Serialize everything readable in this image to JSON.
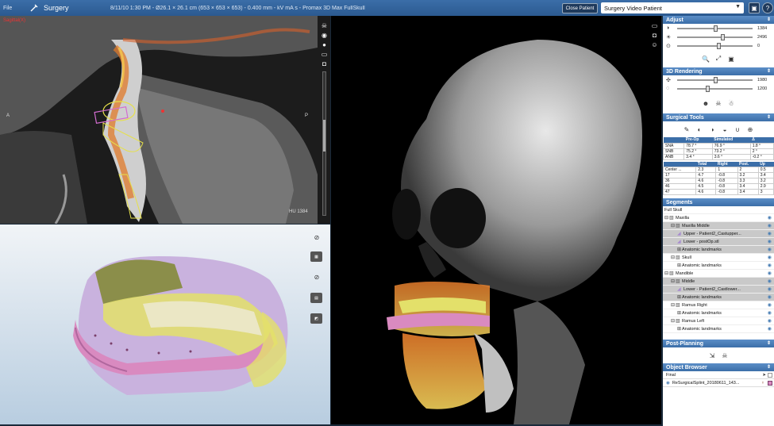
{
  "topbar": {
    "file_label": "File",
    "app_title": "Surgery",
    "scan_info": "8/11/10 1:30 PM - Ø26.1 × 26.1 cm (653 × 653 × 653) - 0.400 mm - kV mA s - Promax 3D Max FullSkull",
    "close_patient_label": "Close Patient",
    "patient_select_value": "Surgery Video Patient"
  },
  "sagittal_view": {
    "view_label": "Sagittal(X)",
    "orientation_left": "A",
    "orientation_right": "P",
    "hu_readout": "HU 1384"
  },
  "adjust": {
    "header": "Adjust",
    "sliders": [
      {
        "icon": "brightness-icon",
        "value": "1384",
        "fraction": 0.5
      },
      {
        "icon": "contrast-icon",
        "value": "2496",
        "fraction": 0.6
      },
      {
        "icon": "sharpness-icon",
        "value": "0",
        "fraction": 0.55
      }
    ]
  },
  "rendering": {
    "header": "3D Rendering",
    "sliders": [
      {
        "icon": "threshold-icon",
        "value": "1980",
        "fraction": 0.5
      },
      {
        "icon": "opacity-icon",
        "value": "1200",
        "fraction": 0.4
      }
    ]
  },
  "surgical_tools": {
    "header": "Surgical Tools",
    "ceph_headers": [
      "",
      "Pre-Op",
      "Simulated",
      "Δ"
    ],
    "ceph_rows": [
      [
        "SNA",
        "78.7 °",
        "76.9 °",
        "1.8 °"
      ],
      [
        "SNB",
        "75.2 °",
        "73.2 °",
        "2 °"
      ],
      [
        "ANB",
        "3.4 °",
        "3.6 °",
        "-0.2 °"
      ]
    ],
    "move_headers": [
      "",
      "Total",
      "Right",
      "Post.",
      "Up"
    ],
    "move_rows": [
      [
        "Center ...",
        "2.3",
        "1",
        "2",
        "0.5"
      ],
      [
        "17",
        "4.7",
        "-0.8",
        "3.2",
        "3.4"
      ],
      [
        "36",
        "4.6",
        "-0.8",
        "3.3",
        "3.2"
      ],
      [
        "46",
        "4.5",
        "-0.8",
        "3.4",
        "2.9"
      ],
      [
        "47",
        "4.6",
        "-0.8",
        "3.4",
        "3"
      ]
    ]
  },
  "segments": {
    "header": "Segments",
    "items": [
      {
        "label": "Full Skull",
        "level": 0,
        "selected": false,
        "tree": "",
        "icon": "",
        "eye": false
      },
      {
        "label": "Maxilla",
        "level": 0,
        "selected": false,
        "tree": "⊟",
        "icon": "bone-icon",
        "eye": true
      },
      {
        "label": "Maxilla Middle",
        "level": 1,
        "selected": true,
        "tree": "⊟",
        "icon": "bone-icon",
        "eye": true
      },
      {
        "label": "Upper - Patient2_Castupper...",
        "level": 2,
        "selected": true,
        "tree": "",
        "icon": "mesh-icon",
        "eye": true
      },
      {
        "label": "Lower - postOp.stl",
        "level": 2,
        "selected": true,
        "tree": "",
        "icon": "mesh-icon",
        "eye": true
      },
      {
        "label": "Anatomic landmarks",
        "level": 2,
        "selected": true,
        "tree": "⊞",
        "icon": "",
        "eye": true
      },
      {
        "label": "Skull",
        "level": 1,
        "selected": false,
        "tree": "⊟",
        "icon": "bone-icon",
        "eye": true
      },
      {
        "label": "Anatomic landmarks",
        "level": 2,
        "selected": false,
        "tree": "⊞",
        "icon": "",
        "eye": true
      },
      {
        "label": "Mandible",
        "level": 0,
        "selected": false,
        "tree": "⊟",
        "icon": "bone-icon",
        "eye": true
      },
      {
        "label": "Middle",
        "level": 1,
        "selected": true,
        "tree": "⊟",
        "icon": "bone-icon",
        "eye": true
      },
      {
        "label": "Lower - Patient2_Castlower...",
        "level": 2,
        "selected": true,
        "tree": "",
        "icon": "mesh-icon",
        "eye": true
      },
      {
        "label": "Anatomic landmarks",
        "level": 2,
        "selected": true,
        "tree": "⊞",
        "icon": "",
        "eye": true
      },
      {
        "label": "Ramus Right",
        "level": 1,
        "selected": false,
        "tree": "⊟",
        "icon": "bone-icon",
        "eye": true
      },
      {
        "label": "Anatomic landmarks",
        "level": 2,
        "selected": false,
        "tree": "⊞",
        "icon": "",
        "eye": true
      },
      {
        "label": "Ramus Left",
        "level": 1,
        "selected": false,
        "tree": "⊟",
        "icon": "bone-icon",
        "eye": true
      },
      {
        "label": "Anatomic landmarks",
        "level": 2,
        "selected": false,
        "tree": "⊞",
        "icon": "",
        "eye": true
      }
    ]
  },
  "post_planning": {
    "header": "Post-Planning"
  },
  "object_browser": {
    "header": "Object Browser",
    "root": "Final",
    "item": "ReSurgicalSplint_20180611_143..."
  },
  "colors": {
    "accent": "#3b6ea8",
    "selection": "#c9c9c9",
    "splint": "#d98ac0",
    "model_yellow": "#e3e06a",
    "model_purple": "#c9b2de"
  }
}
